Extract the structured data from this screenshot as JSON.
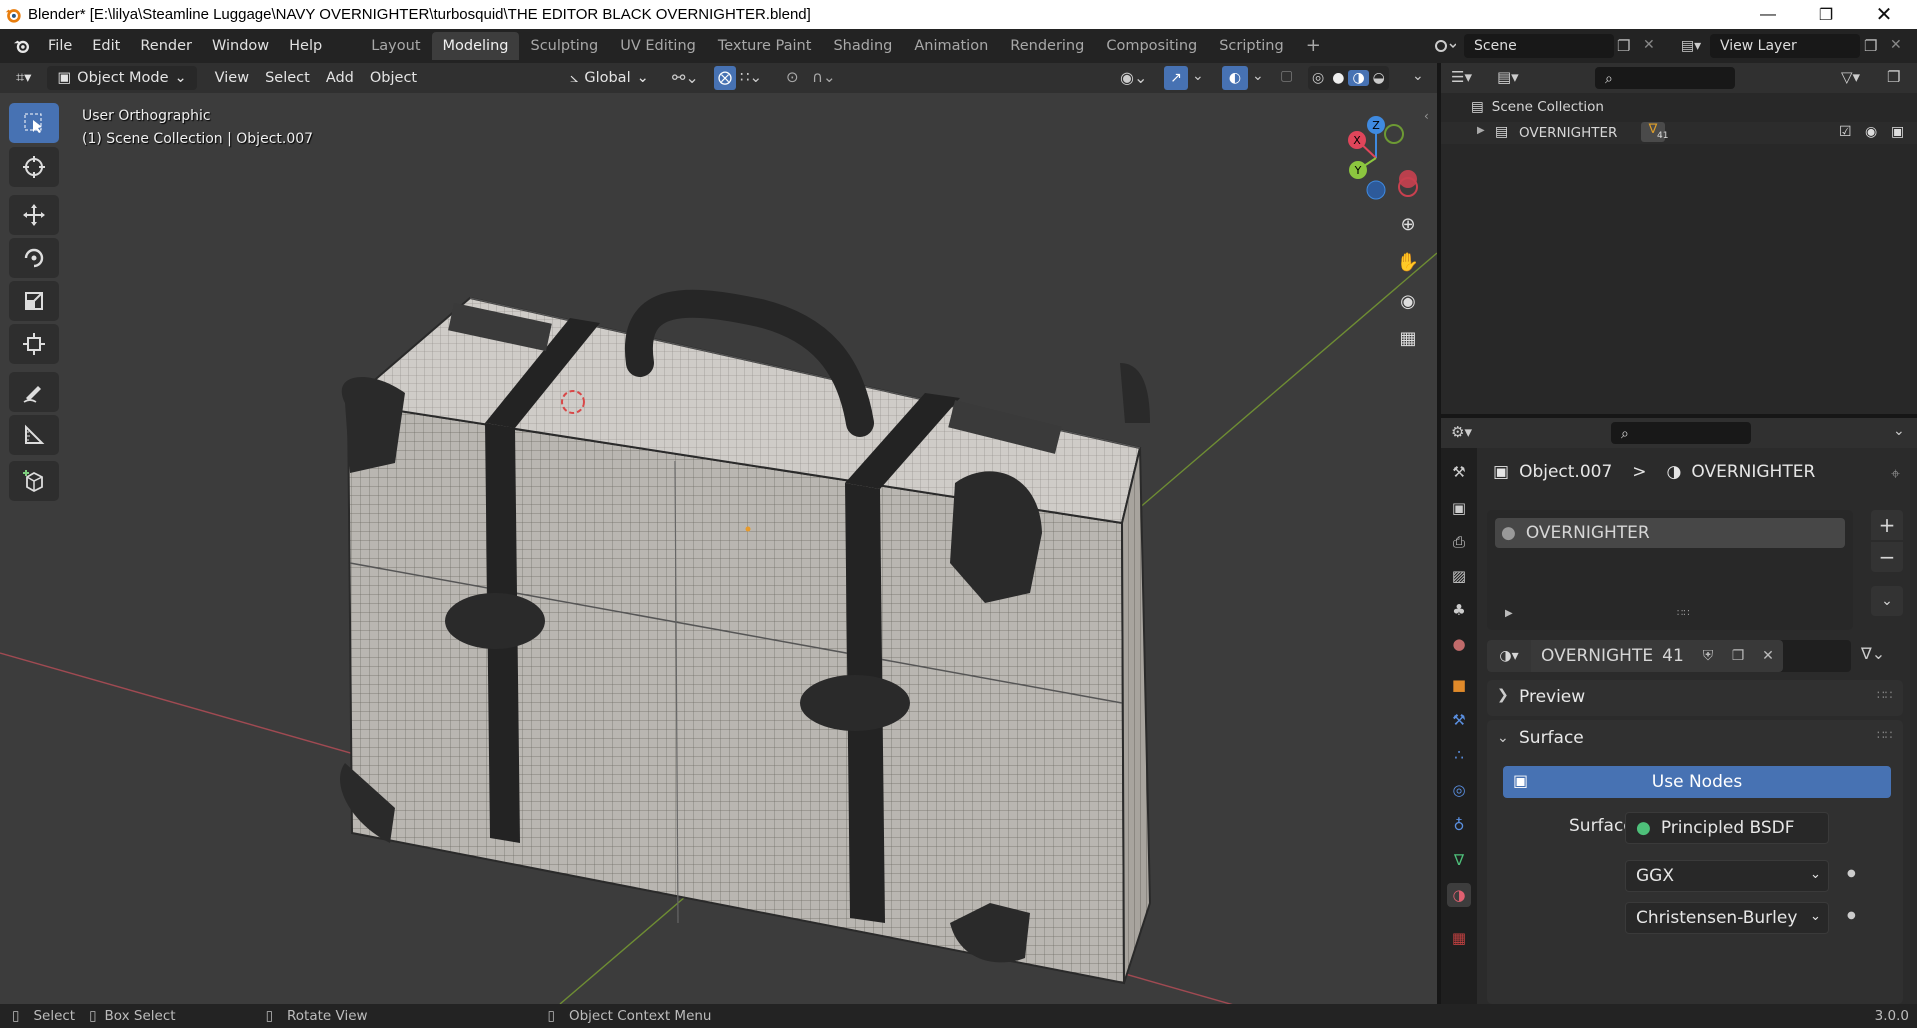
{
  "window": {
    "title": "Blender* [E:\\lilya\\Steamline Luggage\\NAVY OVERNIGHTER\\turbosquid\\THE EDITOR BLACK OVERNIGHTER.blend]"
  },
  "menu": [
    "File",
    "Edit",
    "Render",
    "Window",
    "Help"
  ],
  "workspaces": [
    "Layout",
    "Modeling",
    "Sculpting",
    "UV Editing",
    "Texture Paint",
    "Shading",
    "Animation",
    "Rendering",
    "Compositing",
    "Scripting"
  ],
  "workspace_add": "+",
  "scene": {
    "name": "Scene",
    "view_layer": "View Layer"
  },
  "viewport": {
    "mode": "Object Mode",
    "menus": [
      "View",
      "Select",
      "Add",
      "Object"
    ],
    "transform_orientation": "Global",
    "info_line1": "User Orthographic",
    "info_line2": "(1) Scene Collection | Object.007",
    "gizmo": {
      "x": "X",
      "y": "Y",
      "z": "Z"
    }
  },
  "outliner": {
    "root": "Scene Collection",
    "items": [
      {
        "name": "OVERNIGHTER",
        "badge": "41"
      }
    ]
  },
  "properties": {
    "breadcrumb_object": "Object.007",
    "breadcrumb_sep": ">",
    "breadcrumb_material": "OVERNIGHTER",
    "slot_name": "OVERNIGHTER",
    "material_name": "OVERNIGHTER",
    "user_count": "41",
    "panels": {
      "preview": "Preview",
      "surface": "Surface"
    },
    "use_nodes": "Use Nodes",
    "surface_label": "Surface",
    "surface_value": "Principled BSDF",
    "distribution": "GGX",
    "subsurface": "Christensen-Burley"
  },
  "status": {
    "select": "Select",
    "box_select": "Box Select",
    "rotate_view": "Rotate View",
    "context_menu": "Object Context Menu",
    "version": "3.0.0"
  },
  "colors": {
    "accent": "#4772b3",
    "viewport_bg": "#3c3c3c",
    "axis_x": "#e0455a",
    "axis_y": "#8cc63f",
    "axis_z": "#3f8ae0"
  }
}
